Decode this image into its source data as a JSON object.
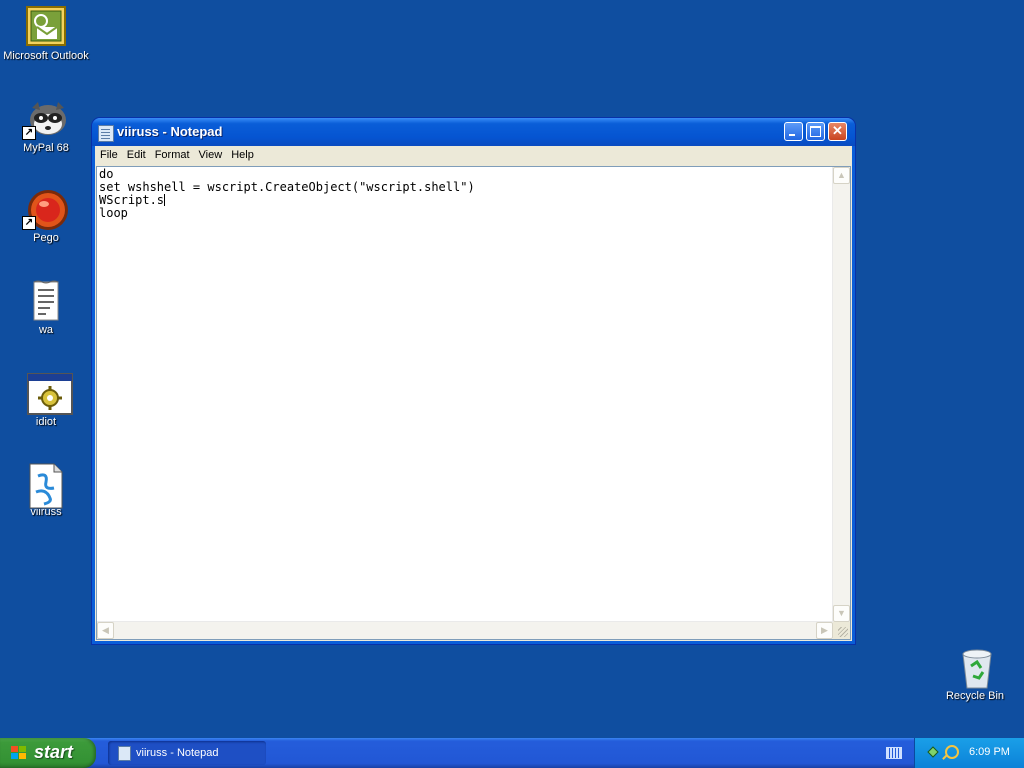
{
  "desktop": {
    "icons": [
      {
        "label": "Microsoft Outlook"
      },
      {
        "label": "MyPal 68"
      },
      {
        "label": "Pego"
      },
      {
        "label": "wa"
      },
      {
        "label": "idiot"
      },
      {
        "label": "viiruss"
      },
      {
        "label": "Recycle Bin"
      }
    ]
  },
  "window": {
    "title": "viiruss - Notepad",
    "menu": [
      "File",
      "Edit",
      "Format",
      "View",
      "Help"
    ],
    "lines": [
      "do",
      "set wshshell = wscript.CreateObject(\"wscript.shell\")",
      "WScript.s",
      "loop"
    ]
  },
  "taskbar": {
    "start_label": "start",
    "task_label": "viiruss - Notepad",
    "clock": "6:09 PM"
  },
  "colors": {
    "desktop": "#0f4ea0",
    "titlebar": "#0a5ed8",
    "start": "#3c9a3a"
  }
}
